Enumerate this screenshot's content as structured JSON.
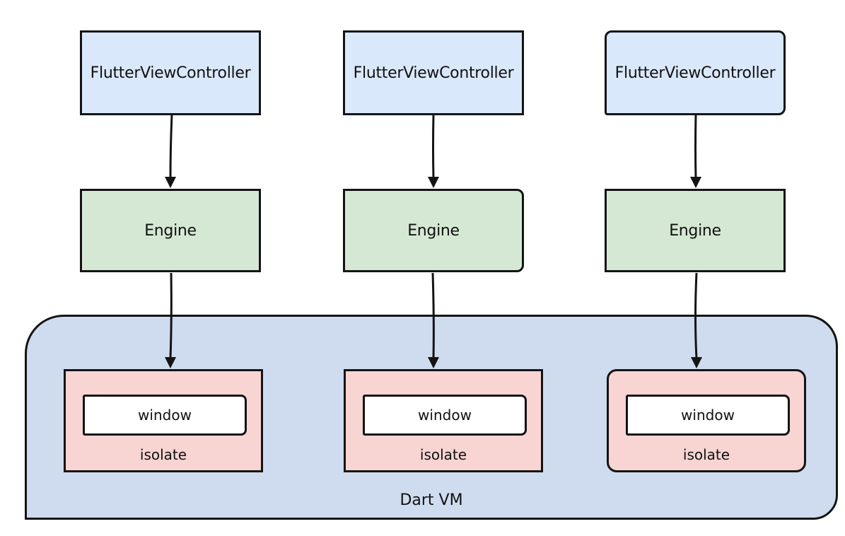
{
  "diagram": {
    "columns": [
      {
        "controller": "FlutterViewController",
        "engine": "Engine",
        "window": "window",
        "isolate": "isolate"
      },
      {
        "controller": "FlutterViewController",
        "engine": "Engine",
        "window": "window",
        "isolate": "isolate"
      },
      {
        "controller": "FlutterViewController",
        "engine": "Engine",
        "window": "window",
        "isolate": "isolate"
      }
    ],
    "container_label": "Dart VM",
    "colors": {
      "controller_fill": "#dae8fc",
      "engine_fill": "#d5e8d4",
      "dart_vm_fill": "#cfdcef",
      "isolate_fill": "#f8d4d3",
      "window_fill": "#ffffff",
      "stroke": "#141414"
    }
  }
}
